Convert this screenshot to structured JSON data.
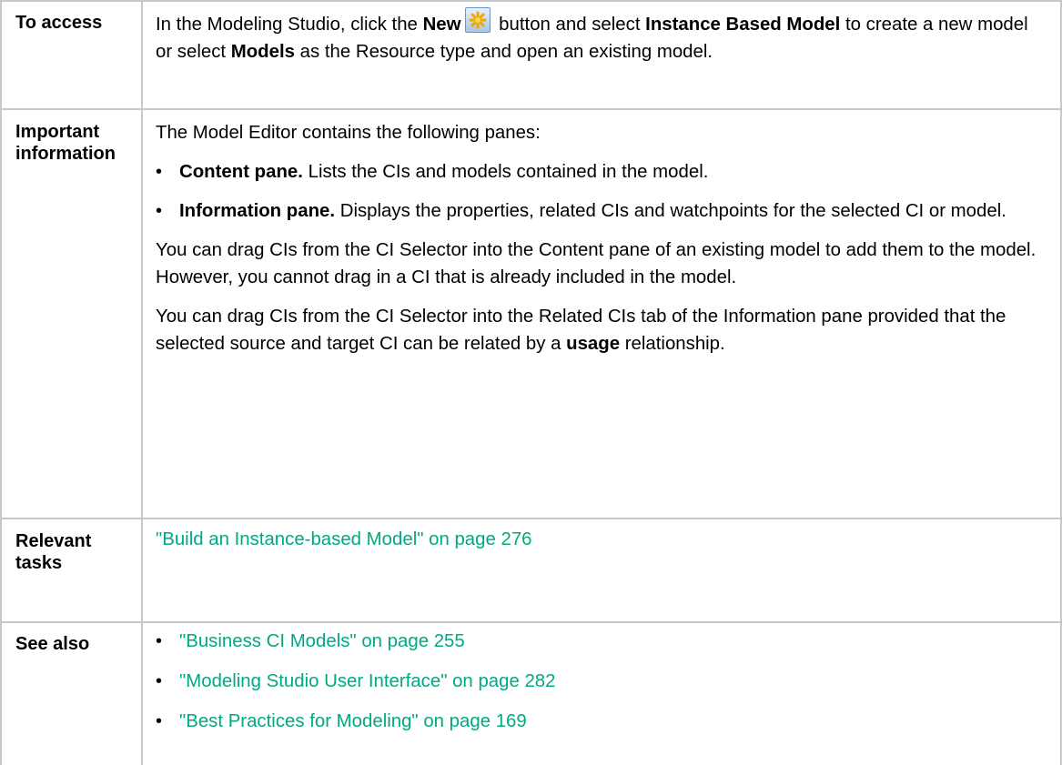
{
  "rows": {
    "access": {
      "label": "To access",
      "t1": "In the Modeling Studio, click the ",
      "b1": "New",
      "t2": " button and select ",
      "b2": "Instance Based Model",
      "t3": " to create a new model or select ",
      "b3": "Models",
      "t4": " as the Resource type and open an existing model."
    },
    "important": {
      "label_line1": "Important",
      "label_line2": "information",
      "intro": "The Model Editor contains the following panes:",
      "bullets": [
        {
          "bold": "Content pane.",
          "text": " Lists the CIs and models contained in the model."
        },
        {
          "bold": "Information pane.",
          "text": " Displays the properties, related CIs and watchpoints for the selected CI or model."
        }
      ],
      "para1": "You can drag CIs from the CI Selector into the Content pane of an existing model to add them to the model. However, you cannot drag in a CI that is already included in the model.",
      "para2_text": "You can drag CIs from the CI Selector into the Related CIs tab of the Information pane provided that the selected source and target CI can be related by a ",
      "para2_bold": "usage",
      "para2_end": " relationship."
    },
    "relevant": {
      "label_line1": "Relevant",
      "label_line2": "tasks",
      "link": "\"Build an Instance-based Model\" on page 276"
    },
    "see_also": {
      "label": "See also",
      "links": [
        "\"Business CI Models\" on page 255",
        "\"Modeling Studio User Interface\" on page 282",
        "\"Best Practices for Modeling\" on page 169"
      ]
    }
  },
  "colors": {
    "link": "#01a982",
    "border": "#c8c8c8"
  },
  "icons": {
    "new_button": "new-star-icon"
  }
}
